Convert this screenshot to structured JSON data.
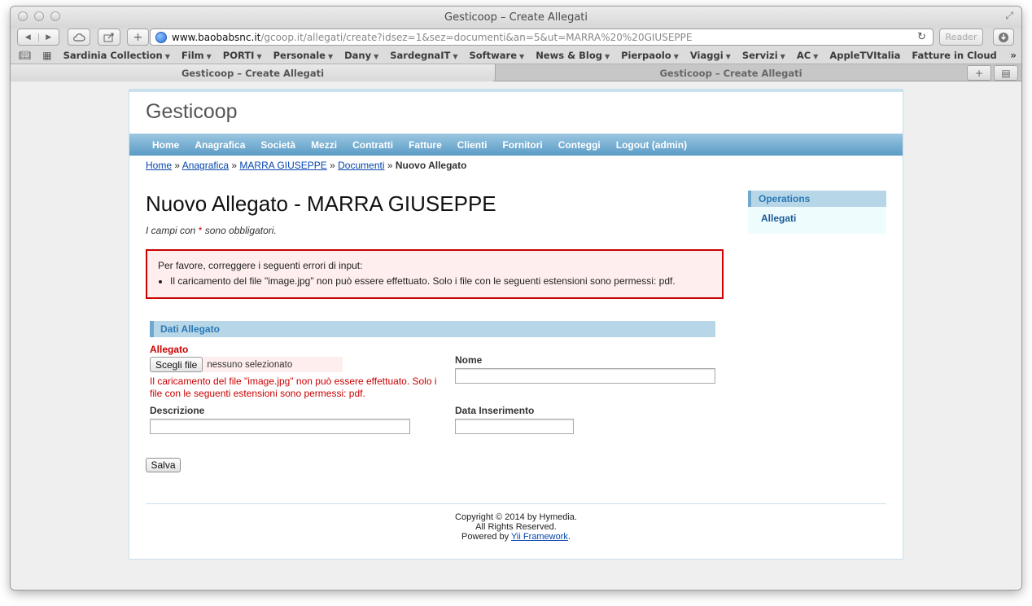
{
  "browser": {
    "window_title": "Gesticoop – Create Allegati",
    "url_host": "www.baobabsnc.it",
    "url_rest": "/gcoop.it/allegati/create?idsez=1&sez=documenti&an=5&ut=MARRA%20%20GIUSEPPE",
    "reader_label": "Reader",
    "bookmarks": [
      {
        "label": "Sardinia Collection",
        "menu": true
      },
      {
        "label": "Film",
        "menu": true
      },
      {
        "label": "PORTI",
        "menu": true
      },
      {
        "label": "Personale",
        "menu": true
      },
      {
        "label": "Dany",
        "menu": true
      },
      {
        "label": "SardegnaIT",
        "menu": true
      },
      {
        "label": "Software",
        "menu": true
      },
      {
        "label": "News & Blog",
        "menu": true
      },
      {
        "label": "Pierpaolo",
        "menu": true
      },
      {
        "label": "Viaggi",
        "menu": true
      },
      {
        "label": "Servizi",
        "menu": true
      },
      {
        "label": "AC",
        "menu": true
      },
      {
        "label": "AppleTVItalia",
        "menu": false
      },
      {
        "label": "Fatture in Cloud",
        "menu": false
      }
    ],
    "tabs": [
      "Gesticoop – Create Allegati",
      "Gesticoop – Create Allegati"
    ]
  },
  "site": {
    "logo": "Gesticoop",
    "menu": [
      "Home",
      "Anagrafica",
      "Società",
      "Mezzi",
      "Contratti",
      "Fatture",
      "Clienti",
      "Fornitori",
      "Conteggi",
      "Logout (admin)"
    ],
    "breadcrumb": {
      "links": [
        "Home",
        "Anagrafica",
        "MARRA GIUSEPPE",
        "Documenti"
      ],
      "separator": " » ",
      "current": "Nuovo Allegato"
    }
  },
  "form": {
    "title": "Nuovo Allegato - MARRA GIUSEPPE",
    "note_prefix": "I campi con",
    "note_star": "*",
    "note_suffix": "sono obbligatori.",
    "error_summary": {
      "heading": "Per favore, correggere i seguenti errori di input:",
      "items": [
        "Il caricamento del file \"image.jpg\" non può essere effettuato. Solo i file con le seguenti estensioni sono permessi: pdf."
      ]
    },
    "fieldset_legend": "Dati Allegato",
    "allegato_label": "Allegato",
    "file_button": "Scegli file",
    "file_status": "nessuno selezionato",
    "allegato_error": "Il caricamento del file \"image.jpg\" non può essere effettuato. Solo i file con le seguenti estensioni sono permessi: pdf.",
    "nome_label": "Nome",
    "nome_value": "",
    "descrizione_label": "Descrizione",
    "descrizione_value": "",
    "data_label": "Data Inserimento",
    "data_value": "",
    "save_label": "Salva"
  },
  "sidebar": {
    "title": "Operations",
    "items": [
      "Allegati"
    ]
  },
  "footer": {
    "line1": "Copyright © 2014 by Hymedia.",
    "line2": "All Rights Reserved.",
    "powered_prefix": "Powered by",
    "powered_link": "Yii Framework",
    "powered_suffix": "."
  },
  "colors": {
    "menu_bar": "#5a9bc6",
    "error": "#cc0000",
    "error_bg": "#ffeeee",
    "link": "#0645ad",
    "legend_bg": "#b7d6e7"
  }
}
